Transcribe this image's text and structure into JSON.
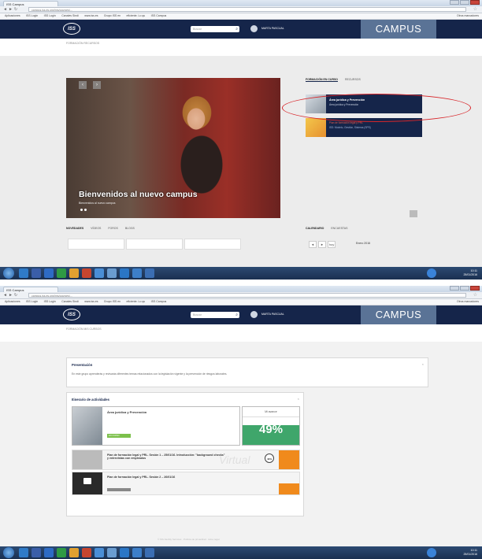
{
  "browser": {
    "tab_title": "ISS Campus",
    "url1": "campus.iss.es.org/lms/courses/...",
    "url2": "campus.iss.es.org/lms/courses/...",
    "bookmarks": [
      "Aplicaciones",
      "ISS Login",
      "ISS Login",
      "Canales Sindi",
      "www.iss.es",
      "Grupo ISS en",
      "eficiente. Lo qu",
      "ISS Campus"
    ],
    "bookmarks_other": "Otros marcadores"
  },
  "header": {
    "logo": "ISS",
    "search_placeholder": "Buscar",
    "username": "MARTA PASCUAL",
    "brand": "CAMPUS"
  },
  "shot1": {
    "breadcrumb": "FORMACIÓN  RECURSOS",
    "hero_title": "Bienvenidos al nuevo campus",
    "hero_subtitle": "Bienvenidos al nuevo campus",
    "panel_tabs": [
      "FORMACIÓN EN CURSO",
      "RECURSOS"
    ],
    "cards": [
      {
        "title": "Área jurídica y Prevención",
        "subtitle": "Área jurídica y Prevención"
      },
      {
        "title": "Plan de formación legal y PRL",
        "subtitle": "ISS: Modelo, Gestión, Sistema (SPS)"
      }
    ],
    "bottom_tabs": [
      "NOVEDADES",
      "VÍDEOS",
      "FOROS",
      "BLOGS"
    ],
    "calendar_tabs": [
      "CALENDARIO",
      "ENCUESTAS"
    ],
    "pager": [
      "◄",
      "►",
      "hoy"
    ],
    "month": "Enero 2016"
  },
  "shot2": {
    "breadcrumb": "FORMACIÓN  MIS CURSOS",
    "presentation_title": "Presentación",
    "presentation_text": "En este grupo aprenderás y revisarás diferentes temas relacionados con la legislación vigente y la prevención de riesgos laborales.",
    "itinerary_title": "Itinerario de actividades",
    "activity_title": "Área jurídica y Prevención",
    "activity_badge": "EN CURSO",
    "progress_label": "Mi avance",
    "progress_pct": "49%",
    "progress_value": 0.49,
    "session1_text": "Plan de formación legal y PRL. Sesión 1 – 25/01/16. Introducción: \"background checks\" y entrevistas con empleados",
    "session2_text": "Plan de formación legal y PRL. Sesión 2 – 26/01/16",
    "badge_pct": "49%",
    "watermark": "Virtual",
    "footer": "© ISS Facility Services · Política de privacidad · Aviso legal"
  },
  "taskbar": {
    "time": "10:11",
    "date": "25/01/2016"
  }
}
